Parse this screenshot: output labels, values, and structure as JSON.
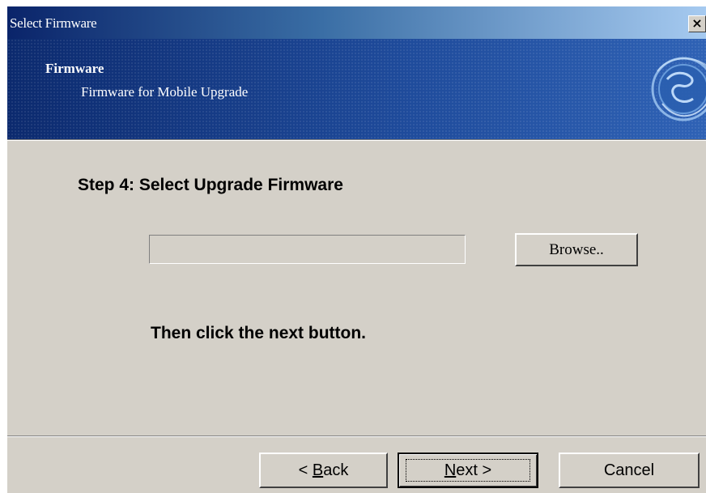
{
  "window": {
    "title": "Select Firmware",
    "close_glyph": "×"
  },
  "banner": {
    "title": "Firmware",
    "subtitle": "Firmware for Mobile Upgrade",
    "logo_icon": "globe-icon"
  },
  "content": {
    "step_title": "Step 4: Select Upgrade Firmware",
    "file_path_value": "",
    "file_path_placeholder": "",
    "browse_label": "Browse..",
    "instruction": "Then click the next button."
  },
  "footer": {
    "back_prefix": "< ",
    "back_mnemonic": "B",
    "back_rest": "ack",
    "next_mnemonic": "N",
    "next_rest": "ext >",
    "cancel_label": "Cancel"
  },
  "colors": {
    "face": "#d4d0c8",
    "title_gradient_start": "#0a246a",
    "title_gradient_end": "#a6caf0",
    "banner_blue": "#1e4a9a"
  }
}
